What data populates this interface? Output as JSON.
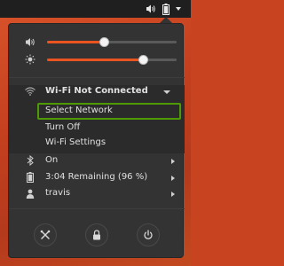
{
  "colors": {
    "accent": "#e95420",
    "focus": "#4e9a06",
    "menu_bg": "#333333",
    "topbar_bg": "#1f1f1f"
  },
  "tray": {
    "icons": [
      "volume-icon",
      "battery-icon",
      "dropdown-arrow-icon"
    ]
  },
  "sliders": {
    "volume": {
      "icon": "volume-icon",
      "level": 0.44
    },
    "brightness": {
      "icon": "brightness-icon",
      "level": 0.74
    }
  },
  "wifi": {
    "title": "Wi-Fi Not Connected",
    "items": [
      {
        "label": "Select Network"
      },
      {
        "label": "Turn Off"
      },
      {
        "label": "Wi-Fi Settings"
      }
    ]
  },
  "bluetooth": {
    "label": "On",
    "icon": "bluetooth-icon"
  },
  "battery": {
    "label": "3:04 Remaining (96 %)",
    "icon": "battery-icon"
  },
  "user": {
    "label": "travis",
    "icon": "user-icon"
  },
  "actions": [
    {
      "name": "settings-button",
      "icon": "tools-icon"
    },
    {
      "name": "lock-button",
      "icon": "lock-icon"
    },
    {
      "name": "power-button",
      "icon": "power-icon"
    }
  ]
}
